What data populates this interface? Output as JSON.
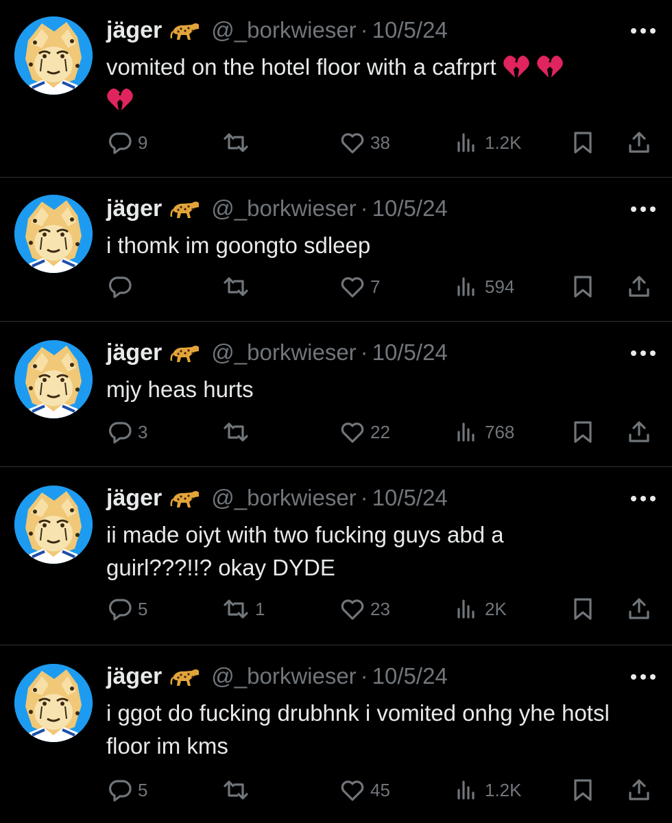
{
  "tweets": [
    {
      "display_name": "jäger",
      "handle": "@_borkwieser",
      "separator": "·",
      "date": "10/5/24",
      "text": "vomited on the hotel floor with a cafrprt",
      "emojis": [
        "broken-heart",
        "broken-heart",
        "broken-heart"
      ],
      "replies": "9",
      "retweets": "",
      "likes": "38",
      "views": "1.2K"
    },
    {
      "display_name": "jäger",
      "handle": "@_borkwieser",
      "separator": "·",
      "date": "10/5/24",
      "text": "i thomk im goongto sdleep",
      "emojis": [],
      "replies": "",
      "retweets": "",
      "likes": "7",
      "views": "594"
    },
    {
      "display_name": "jäger",
      "handle": "@_borkwieser",
      "separator": "·",
      "date": "10/5/24",
      "text": "mjy heas hurts",
      "emojis": [],
      "replies": "3",
      "retweets": "",
      "likes": "22",
      "views": "768"
    },
    {
      "display_name": "jäger",
      "handle": "@_borkwieser",
      "separator": "·",
      "date": "10/5/24",
      "text": "ii made oiyt with two fucking guys abd a guirl???!!? okay DYDE",
      "emojis": [],
      "replies": "5",
      "retweets": "1",
      "likes": "23",
      "views": "2K"
    },
    {
      "display_name": "jäger",
      "handle": "@_borkwieser",
      "separator": "·",
      "date": "10/5/24",
      "text": "i ggot do fucking drubhnk i vomited onhg yhe hotsl floor im kms",
      "emojis": [],
      "replies": "5",
      "retweets": "",
      "likes": "45",
      "views": "1.2K"
    }
  ],
  "icons": {
    "verified_badge": "cheetah-emoji",
    "more": "more-options-icon",
    "reply": "reply-icon",
    "retweet": "retweet-icon",
    "like": "heart-icon",
    "views": "views-icon",
    "bookmark": "bookmark-icon",
    "share": "share-icon"
  },
  "colors": {
    "background": "#000000",
    "text_primary": "#e7e9ea",
    "text_secondary": "#71767b",
    "divider": "#2f3336",
    "avatar_bg": "#1d9bf0",
    "broken_heart": "#e0245e"
  }
}
